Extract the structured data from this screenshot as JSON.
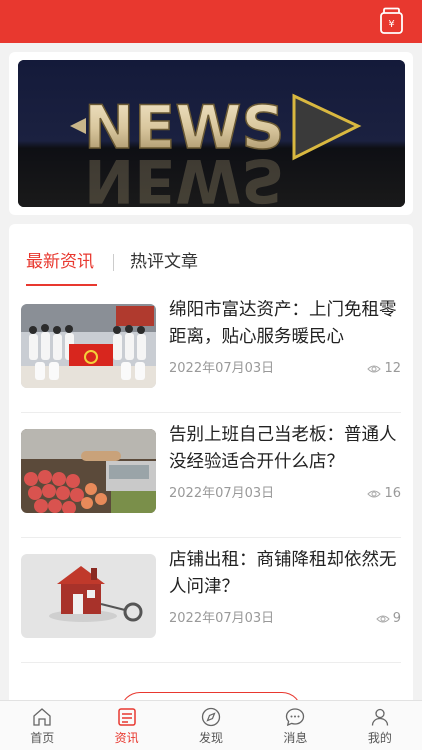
{
  "banner": {
    "text": "NEWS"
  },
  "tabs": {
    "latest": "最新资讯",
    "hot": "热评文章"
  },
  "articles": [
    {
      "title": "绵阳市富达资产：上门免租零距离，贴心服务暖民心",
      "date": "2022年07月03日",
      "views": "12",
      "image": "group-photo-with-flag"
    },
    {
      "title": "告别上班自己当老板：普通人没经验适合开什么店？",
      "date": "2022年07月03日",
      "views": "16",
      "image": "fruit-stall"
    },
    {
      "title": "店铺出租：商铺降租却依然无人问津？",
      "date": "2022年07月03日",
      "views": "9",
      "image": "house-with-key"
    }
  ],
  "nav": [
    {
      "label": "首页",
      "icon": "home-icon"
    },
    {
      "label": "资讯",
      "icon": "news-icon",
      "active": true
    },
    {
      "label": "发现",
      "icon": "compass-icon"
    },
    {
      "label": "消息",
      "icon": "chat-icon"
    },
    {
      "label": "我的",
      "icon": "user-icon"
    }
  ],
  "colors": {
    "accent": "#e8382f",
    "muted": "#999999"
  }
}
